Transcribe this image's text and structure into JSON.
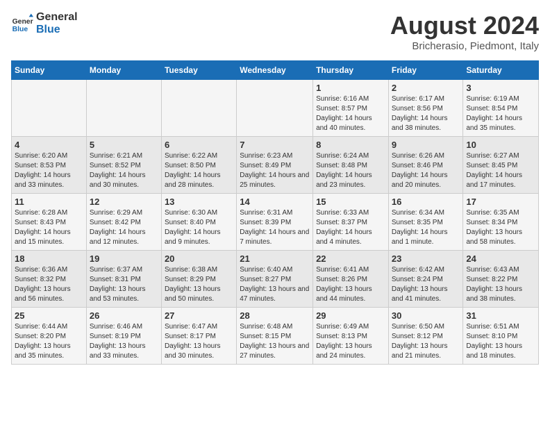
{
  "header": {
    "logo_line1": "General",
    "logo_line2": "Blue",
    "month_year": "August 2024",
    "location": "Bricherasio, Piedmont, Italy"
  },
  "weekdays": [
    "Sunday",
    "Monday",
    "Tuesday",
    "Wednesday",
    "Thursday",
    "Friday",
    "Saturday"
  ],
  "weeks": [
    [
      {
        "day": "",
        "info": ""
      },
      {
        "day": "",
        "info": ""
      },
      {
        "day": "",
        "info": ""
      },
      {
        "day": "",
        "info": ""
      },
      {
        "day": "1",
        "info": "Sunrise: 6:16 AM\nSunset: 8:57 PM\nDaylight: 14 hours and 40 minutes."
      },
      {
        "day": "2",
        "info": "Sunrise: 6:17 AM\nSunset: 8:56 PM\nDaylight: 14 hours and 38 minutes."
      },
      {
        "day": "3",
        "info": "Sunrise: 6:19 AM\nSunset: 8:54 PM\nDaylight: 14 hours and 35 minutes."
      }
    ],
    [
      {
        "day": "4",
        "info": "Sunrise: 6:20 AM\nSunset: 8:53 PM\nDaylight: 14 hours and 33 minutes."
      },
      {
        "day": "5",
        "info": "Sunrise: 6:21 AM\nSunset: 8:52 PM\nDaylight: 14 hours and 30 minutes."
      },
      {
        "day": "6",
        "info": "Sunrise: 6:22 AM\nSunset: 8:50 PM\nDaylight: 14 hours and 28 minutes."
      },
      {
        "day": "7",
        "info": "Sunrise: 6:23 AM\nSunset: 8:49 PM\nDaylight: 14 hours and 25 minutes."
      },
      {
        "day": "8",
        "info": "Sunrise: 6:24 AM\nSunset: 8:48 PM\nDaylight: 14 hours and 23 minutes."
      },
      {
        "day": "9",
        "info": "Sunrise: 6:26 AM\nSunset: 8:46 PM\nDaylight: 14 hours and 20 minutes."
      },
      {
        "day": "10",
        "info": "Sunrise: 6:27 AM\nSunset: 8:45 PM\nDaylight: 14 hours and 17 minutes."
      }
    ],
    [
      {
        "day": "11",
        "info": "Sunrise: 6:28 AM\nSunset: 8:43 PM\nDaylight: 14 hours and 15 minutes."
      },
      {
        "day": "12",
        "info": "Sunrise: 6:29 AM\nSunset: 8:42 PM\nDaylight: 14 hours and 12 minutes."
      },
      {
        "day": "13",
        "info": "Sunrise: 6:30 AM\nSunset: 8:40 PM\nDaylight: 14 hours and 9 minutes."
      },
      {
        "day": "14",
        "info": "Sunrise: 6:31 AM\nSunset: 8:39 PM\nDaylight: 14 hours and 7 minutes."
      },
      {
        "day": "15",
        "info": "Sunrise: 6:33 AM\nSunset: 8:37 PM\nDaylight: 14 hours and 4 minutes."
      },
      {
        "day": "16",
        "info": "Sunrise: 6:34 AM\nSunset: 8:35 PM\nDaylight: 14 hours and 1 minute."
      },
      {
        "day": "17",
        "info": "Sunrise: 6:35 AM\nSunset: 8:34 PM\nDaylight: 13 hours and 58 minutes."
      }
    ],
    [
      {
        "day": "18",
        "info": "Sunrise: 6:36 AM\nSunset: 8:32 PM\nDaylight: 13 hours and 56 minutes."
      },
      {
        "day": "19",
        "info": "Sunrise: 6:37 AM\nSunset: 8:31 PM\nDaylight: 13 hours and 53 minutes."
      },
      {
        "day": "20",
        "info": "Sunrise: 6:38 AM\nSunset: 8:29 PM\nDaylight: 13 hours and 50 minutes."
      },
      {
        "day": "21",
        "info": "Sunrise: 6:40 AM\nSunset: 8:27 PM\nDaylight: 13 hours and 47 minutes."
      },
      {
        "day": "22",
        "info": "Sunrise: 6:41 AM\nSunset: 8:26 PM\nDaylight: 13 hours and 44 minutes."
      },
      {
        "day": "23",
        "info": "Sunrise: 6:42 AM\nSunset: 8:24 PM\nDaylight: 13 hours and 41 minutes."
      },
      {
        "day": "24",
        "info": "Sunrise: 6:43 AM\nSunset: 8:22 PM\nDaylight: 13 hours and 38 minutes."
      }
    ],
    [
      {
        "day": "25",
        "info": "Sunrise: 6:44 AM\nSunset: 8:20 PM\nDaylight: 13 hours and 35 minutes."
      },
      {
        "day": "26",
        "info": "Sunrise: 6:46 AM\nSunset: 8:19 PM\nDaylight: 13 hours and 33 minutes."
      },
      {
        "day": "27",
        "info": "Sunrise: 6:47 AM\nSunset: 8:17 PM\nDaylight: 13 hours and 30 minutes."
      },
      {
        "day": "28",
        "info": "Sunrise: 6:48 AM\nSunset: 8:15 PM\nDaylight: 13 hours and 27 minutes."
      },
      {
        "day": "29",
        "info": "Sunrise: 6:49 AM\nSunset: 8:13 PM\nDaylight: 13 hours and 24 minutes."
      },
      {
        "day": "30",
        "info": "Sunrise: 6:50 AM\nSunset: 8:12 PM\nDaylight: 13 hours and 21 minutes."
      },
      {
        "day": "31",
        "info": "Sunrise: 6:51 AM\nSunset: 8:10 PM\nDaylight: 13 hours and 18 minutes."
      }
    ]
  ]
}
